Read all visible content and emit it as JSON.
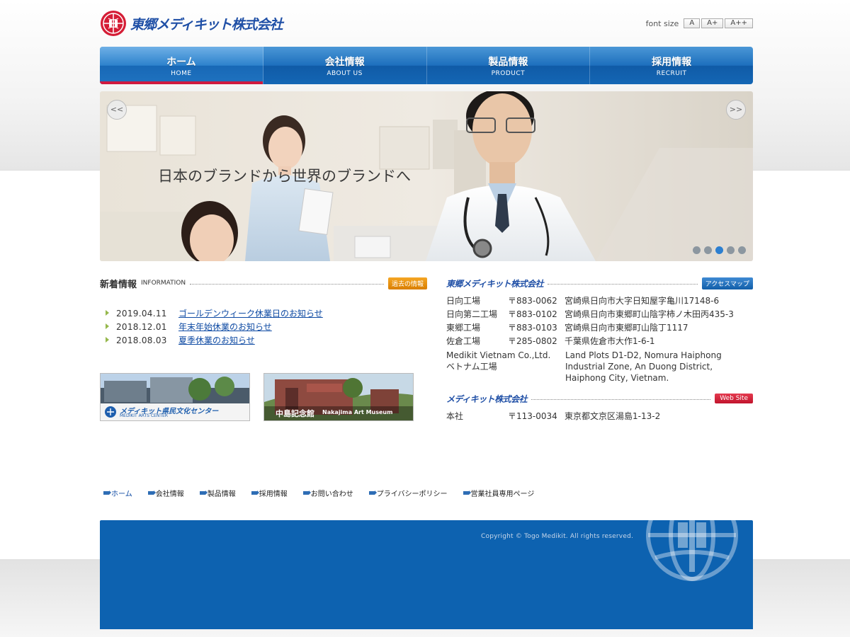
{
  "header": {
    "logo_text": "東郷メディキット株式会社",
    "font_size_label": "font size",
    "font_size_buttons": [
      "A",
      "A+",
      "A++"
    ]
  },
  "nav": [
    {
      "jp": "ホーム",
      "en": "HOME",
      "active": true
    },
    {
      "jp": "会社情報",
      "en": "ABOUT US",
      "active": false
    },
    {
      "jp": "製品情報",
      "en": "PRODUCT",
      "active": false
    },
    {
      "jp": "採用情報",
      "en": "RECRUIT",
      "active": false
    }
  ],
  "hero": {
    "caption": "日本のブランドから世界のブランドへ",
    "prev_label": "<<",
    "next_label": ">>",
    "dots_total": 5,
    "active_dot": 3
  },
  "info": {
    "title": "新着情報",
    "subtitle": "INFORMATION",
    "past_button": "過去の情報",
    "items": [
      {
        "date": "2019.04.11",
        "title": "ゴールデンウィーク休業日のお知らせ"
      },
      {
        "date": "2018.12.01",
        "title": "年末年始休業のお知らせ"
      },
      {
        "date": "2018.08.03",
        "title": "夏季休業のお知らせ"
      }
    ]
  },
  "banners": [
    {
      "label": "メディキット県民文化センター",
      "sub": "MEDIKIT ARTS CENTER"
    },
    {
      "label": "中島記念館",
      "sub": "Nakajima Art Museum"
    }
  ],
  "togo": {
    "name": "東郷メディキット株式会社",
    "access_button": "アクセスマップ",
    "rows": [
      {
        "name": "日向工場",
        "post": "〒883-0062",
        "addr": "宮崎県日向市大字日知屋字亀川17148-6"
      },
      {
        "name": "日向第二工場",
        "post": "〒883-0102",
        "addr": "宮崎県日向市東郷町山陰字柿ノ木田丙435-3"
      },
      {
        "name": "東郷工場",
        "post": "〒883-0103",
        "addr": "宮崎県日向市東郷町山陰丁1117"
      },
      {
        "name": "佐倉工場",
        "post": "〒285-0802",
        "addr": "千葉県佐倉市大作1-6-1"
      }
    ],
    "vietnam": {
      "name1": "Medikit Vietnam Co.,Ltd.",
      "name2": "ベトナム工場",
      "addr1": "Land Plots D1-D2, Nomura Haiphong",
      "addr2": "Industrial Zone, An Duong District,",
      "addr3": "Haiphong City, Vietnam."
    }
  },
  "medikit": {
    "name": "メディキット株式会社",
    "web_button": "Web Site",
    "row": {
      "name": "本社",
      "post": "〒113-0034",
      "addr": "東京都文京区湯島1-13-2"
    }
  },
  "footer_nav": [
    "ホーム",
    "会社情報",
    "製品情報",
    "採用情報",
    "お問い合わせ",
    "プライバシーポリシー",
    "営業社員専用ページ"
  ],
  "copyright": "Copyright © Togo Medikit. All rights reserved.",
  "colors": {
    "nav_blue": "#1d6fbd",
    "active_red": "#d0193f",
    "link_blue": "#0e4aa3",
    "footer_blue": "#0d62b0",
    "past_orange": "#e48b0c"
  }
}
